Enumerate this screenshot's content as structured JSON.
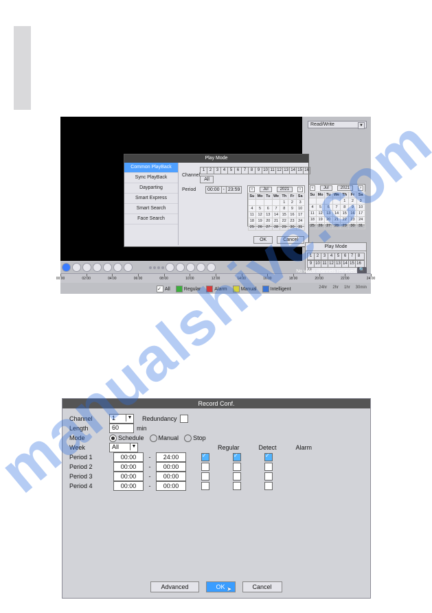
{
  "watermark": "manualshive.com",
  "player": {
    "read_write": "Read/Write",
    "dialog": {
      "title": "Play Mode",
      "menu": [
        "Common PlayBack",
        "Sync PlayBack",
        "Dayparting",
        "Smart Express",
        "Smart Search",
        "Face Search"
      ],
      "channel_label": "Channel",
      "channels": [
        "1",
        "2",
        "3",
        "4",
        "5",
        "6",
        "7",
        "8",
        "9",
        "10",
        "11",
        "12",
        "13",
        "14",
        "15",
        "16"
      ],
      "all": "All",
      "period_label": "Period",
      "period_from": "00:00",
      "period_sep": "-",
      "period_to": "23:59",
      "ok": "OK",
      "cancel": "Cancel"
    },
    "cal1": {
      "month": "Jul",
      "year": "2021",
      "dow": [
        "Su",
        "Mo",
        "Tu",
        "We",
        "Th",
        "Fr",
        "Sa"
      ],
      "weeks": [
        [
          "",
          "",
          "",
          "",
          "1",
          "2",
          "3"
        ],
        [
          "4",
          "5",
          "6",
          "7",
          "8",
          "9",
          "10"
        ],
        [
          "11",
          "12",
          "13",
          "14",
          "15",
          "16",
          "17"
        ],
        [
          "18",
          "19",
          "20",
          "21",
          "22",
          "23",
          "24"
        ],
        [
          "25",
          "26",
          "27",
          "28",
          "29",
          "30",
          "31"
        ]
      ]
    },
    "cal2": {
      "month": "Jul",
      "year": "2021",
      "dow": [
        "Su",
        "Mo",
        "Tu",
        "We",
        "Th",
        "Fr",
        "Sa"
      ],
      "weeks": [
        [
          "",
          "",
          "",
          "",
          "1",
          "2",
          "3"
        ],
        [
          "4",
          "5",
          "6",
          "7",
          "8",
          "9",
          "10"
        ],
        [
          "11",
          "12",
          "13",
          "14",
          "15",
          "16",
          "17"
        ],
        [
          "18",
          "19",
          "20",
          "21",
          "22",
          "23",
          "24"
        ],
        [
          "25",
          "26",
          "27",
          "28",
          "29",
          "30",
          "31"
        ]
      ]
    },
    "small_panel": {
      "title": "Play Mode",
      "row1": [
        "1",
        "2",
        "3",
        "4",
        "5",
        "6",
        "7",
        "8"
      ],
      "row2": [
        "9",
        "10",
        "11",
        "12",
        "13",
        "14",
        "15",
        "16"
      ],
      "all": "All"
    },
    "no_retrieve": "No video channels retrieved",
    "legend": {
      "all": "All",
      "regular": "Regular",
      "alarm": "Alarm",
      "manual": "Manual",
      "intelligent": "Intelligent"
    },
    "zoom": {
      "a": "24hr",
      "b": "2hr",
      "c": "1hr",
      "d": "30min"
    }
  },
  "record": {
    "title": "Record Conf.",
    "labels": {
      "channel": "Channel",
      "redundancy": "Redundancy",
      "length": "Length",
      "min": "min",
      "mode": "Mode",
      "schedule": "Schedule",
      "manual": "Manual",
      "stop": "Stop",
      "week": "Week",
      "regular": "Regular",
      "detect": "Detect",
      "alarm": "Alarm",
      "period1": "Period 1",
      "period2": "Period 2",
      "period3": "Period 3",
      "period4": "Period 4"
    },
    "values": {
      "channel": "1",
      "length": "60",
      "week": "All",
      "p1_from": "00:00",
      "p1_to": "24:00",
      "p2_from": "00:00",
      "p2_to": "00:00",
      "p3_from": "00:00",
      "p3_to": "00:00",
      "p4_from": "00:00",
      "p4_to": "00:00"
    },
    "buttons": {
      "advanced": "Advanced",
      "ok": "OK",
      "cancel": "Cancel"
    }
  }
}
